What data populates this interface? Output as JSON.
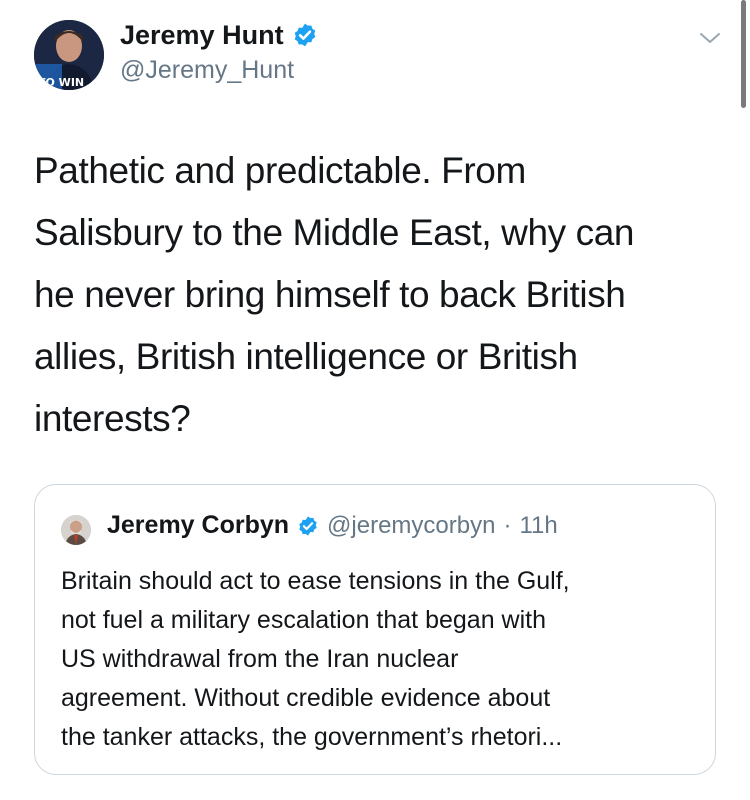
{
  "tweet": {
    "author": {
      "name": "Jeremy Hunt",
      "handle": "@Jeremy_Hunt",
      "verified": true,
      "avatar_text": "TO WIN"
    },
    "text": "Pathetic and predictable. From\nSalisbury to the Middle East, why can\nhe never bring himself to back British\nallies, British intelligence or British\ninterests?",
    "menu_icon": "chevron-down-icon"
  },
  "quoted_tweet": {
    "author": {
      "name": "Jeremy Corbyn",
      "handle": "@jeremycorbyn",
      "verified": true
    },
    "separator": "·",
    "time": "11h",
    "text": "Britain should act to ease tensions in the Gulf,\nnot fuel a military escalation that began with\nUS withdrawal from the Iran nuclear\nagreement. Without credible evidence about\nthe tanker attacks, the government’s rhetori..."
  },
  "colors": {
    "verified": "#1da1f2",
    "secondary_text": "#657786",
    "border": "#ccd6dd"
  }
}
